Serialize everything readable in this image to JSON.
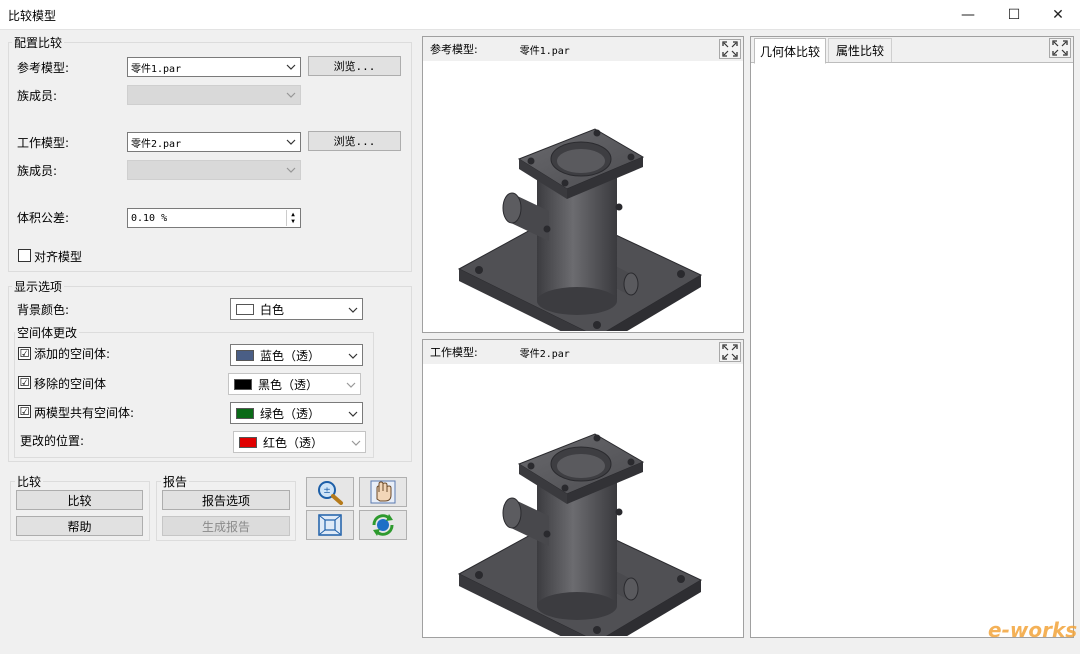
{
  "window": {
    "title": "比较模型",
    "minimize": "—",
    "maximize": "☐",
    "close": "✕"
  },
  "config": {
    "group_label": "配置比较",
    "ref_label": "参考模型:",
    "ref_value": "零件1.par",
    "browse": "浏览...",
    "family_label": "族成员:",
    "work_label": "工作模型:",
    "work_value": "零件2.par",
    "tol_label": "体积公差:",
    "tol_value": "0.10 %",
    "align_label": "对齐模型"
  },
  "display": {
    "group_label": "显示选项",
    "bg_label": "背景颜色:",
    "bg_value": "白色",
    "bg_color": "#ffffff",
    "space_label": "空间体更改",
    "rows": [
      {
        "label": "添加的空间体:",
        "value": "蓝色（透）",
        "color": "#4a5e85",
        "checked": "☑"
      },
      {
        "label": "移除的空间体",
        "value": "黑色（透）",
        "color": "#000000",
        "checked": "☑"
      },
      {
        "label": "两模型共有空间体:",
        "value": "绿色（透）",
        "color": "#0a6a17",
        "checked": "☑"
      },
      {
        "label": "更改的位置:",
        "value": "红色（透）",
        "color": "#e00000",
        "checked": ""
      }
    ]
  },
  "compare": {
    "group_label": "比较",
    "compare_btn": "比较",
    "help_btn": "帮助"
  },
  "report": {
    "group_label": "报告",
    "options_btn": "报告选项",
    "generate_btn": "生成报告"
  },
  "tools": [
    "zoom-icon",
    "pan-icon",
    "fit-icon",
    "rotate-icon"
  ],
  "viewers": {
    "ref": {
      "label": "参考模型:",
      "file": "零件1.par"
    },
    "work": {
      "label": "工作模型:",
      "file": "零件2.par"
    }
  },
  "tabs": [
    {
      "label": "几何体比较"
    },
    {
      "label": "属性比较"
    }
  ],
  "watermark": "e-works"
}
